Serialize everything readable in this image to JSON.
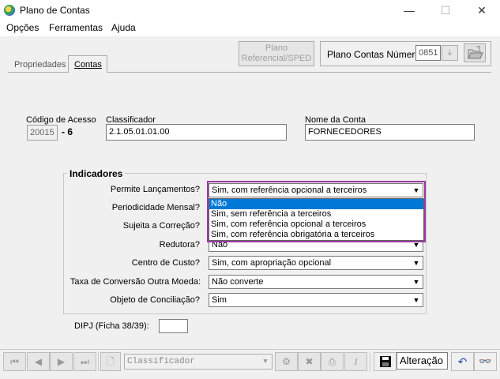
{
  "window": {
    "title": "Plano de Contas",
    "minimize": "—",
    "maximize": "☐",
    "close": "✕"
  },
  "menu": [
    "Opções",
    "Ferramentas",
    "Ajuda"
  ],
  "toolbar": {
    "sped_line1": "Plano",
    "sped_line2": "Referencial/SPED",
    "numero_label": "Plano Contas Número",
    "numero_value": "0851"
  },
  "tabs": {
    "propriedades": "Propriedades",
    "contas": "Contas"
  },
  "form": {
    "codigo_label": "Código de Acesso",
    "codigo_value": "20015",
    "codigo_digit": "- 6",
    "classificador_label": "Classificador",
    "classificador_value": "2.1.05.01.01.00",
    "nome_label": "Nome da Conta",
    "nome_value": "FORNECEDORES"
  },
  "indicadores": {
    "title": "Indicadores",
    "rows": [
      {
        "label": "Permite Lançamentos?",
        "value": "Sim, com referência opcional a terceiros"
      },
      {
        "label": "Periodicidade Mensal?",
        "value": ""
      },
      {
        "label": "Sujeita a Correção?",
        "value": ""
      },
      {
        "label": "Redutora?",
        "value": "Não"
      },
      {
        "label": "Centro de Custo?",
        "value": "Sim, com apropriação opcional"
      },
      {
        "label": "Taxa de Conversão Outra Moeda:",
        "value": "Não converte"
      },
      {
        "label": "Objeto de Conciliação?",
        "value": "Sim"
      }
    ],
    "dropdown_options": [
      "Não",
      "Sim, sem referência a terceiros",
      "Sim, com referência opcional a terceiros",
      "Sim, com referência obrigatória a terceiros"
    ],
    "dropdown_selected_index": 0
  },
  "dipj_label": "DIPJ (Ficha 38/39):",
  "bottom": {
    "classificador_placeholder": "Classificador",
    "mode": "Alteração"
  }
}
